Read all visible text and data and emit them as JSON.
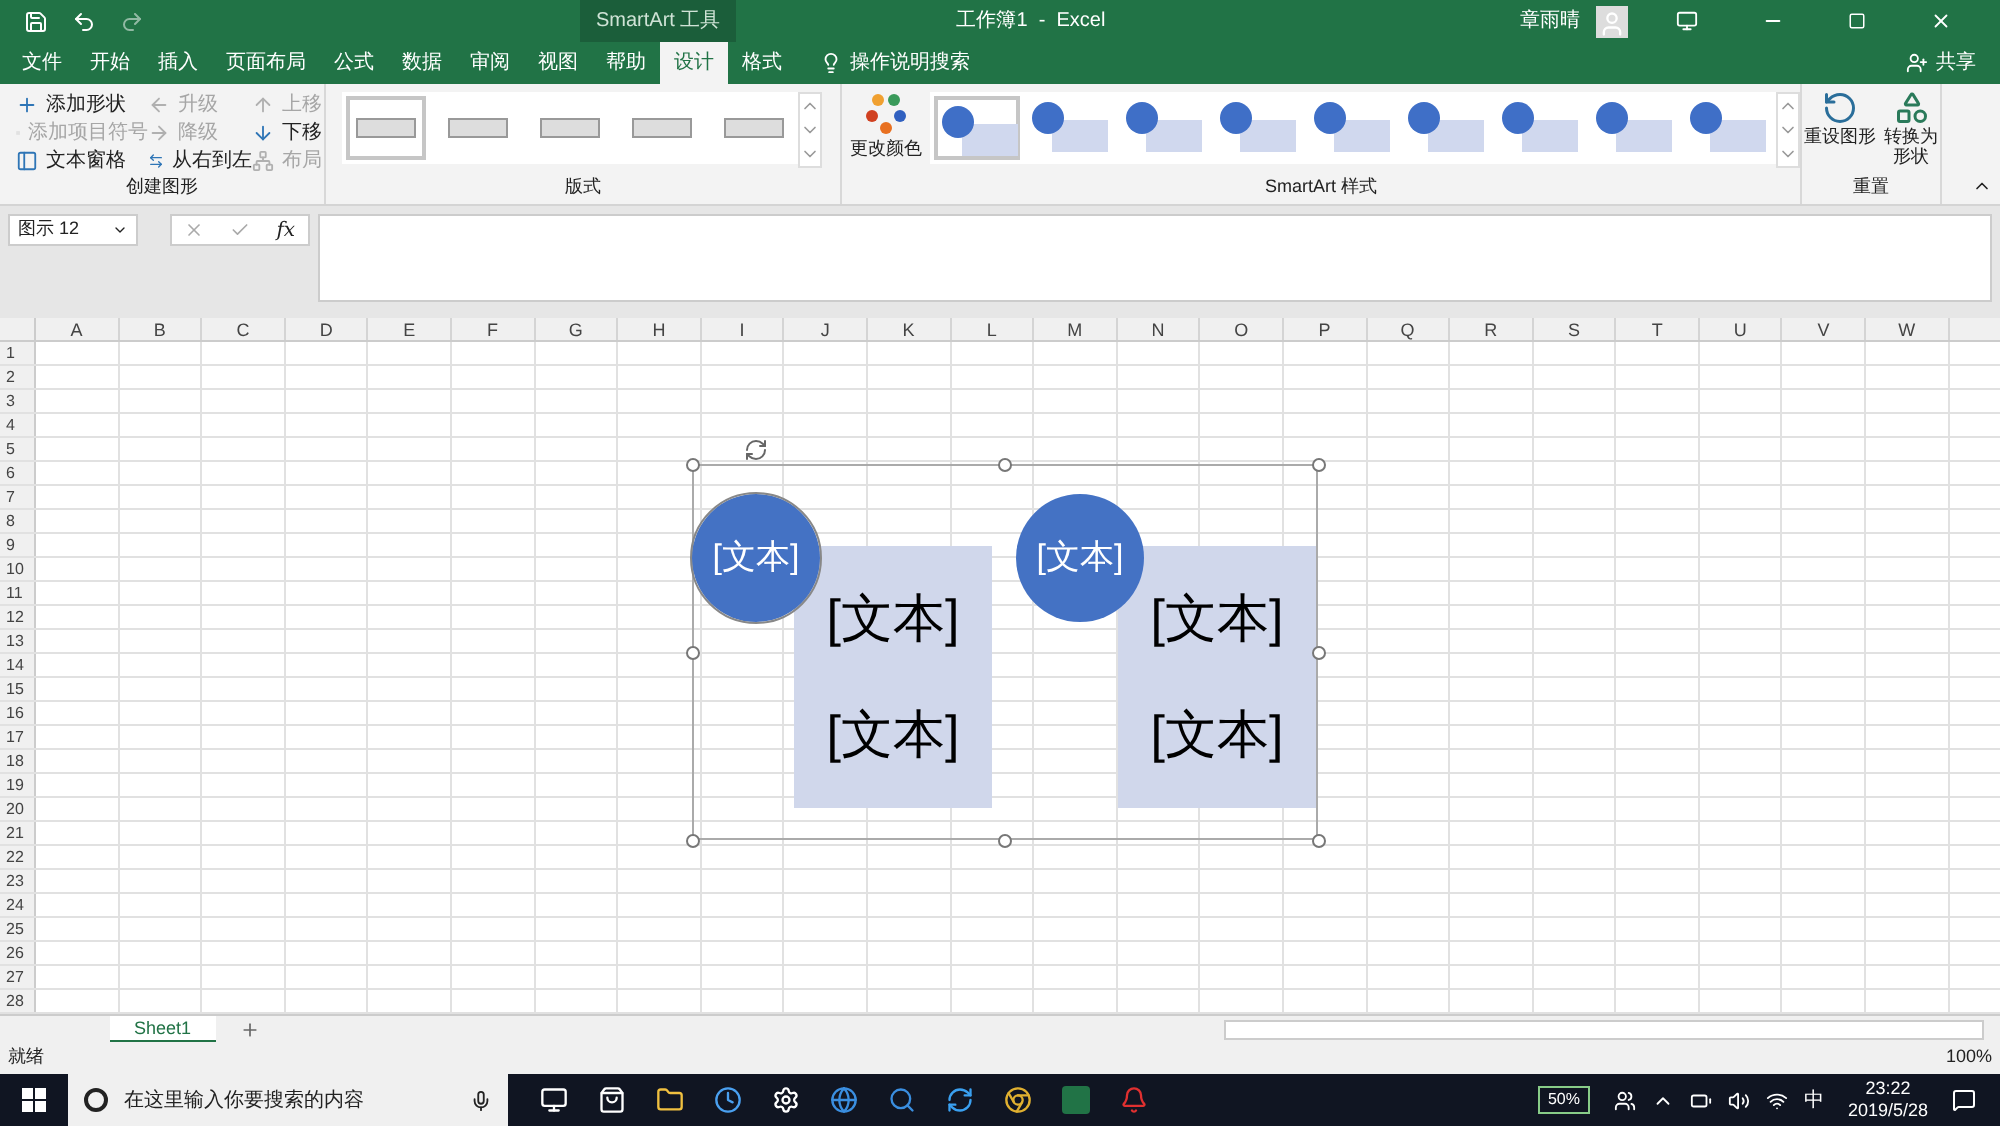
{
  "title_bar": {
    "context_label": "SmartArt 工具",
    "title": "工作簿1  -  Excel",
    "user": "章雨晴"
  },
  "tabs": [
    {
      "label": "文件",
      "selected": false
    },
    {
      "label": "开始",
      "selected": false
    },
    {
      "label": "插入",
      "selected": false
    },
    {
      "label": "页面布局",
      "selected": false
    },
    {
      "label": "公式",
      "selected": false
    },
    {
      "label": "数据",
      "selected": false
    },
    {
      "label": "审阅",
      "selected": false
    },
    {
      "label": "视图",
      "selected": false
    },
    {
      "label": "帮助",
      "selected": false
    },
    {
      "label": "设计",
      "selected": true
    },
    {
      "label": "格式",
      "selected": false
    }
  ],
  "tell_me": "操作说明搜索",
  "share": "共享",
  "create_group": {
    "label": "创建图形",
    "items": [
      {
        "label": "添加形状",
        "disabled": false,
        "kind": "add"
      },
      {
        "label": "升级",
        "disabled": true,
        "kind": "left"
      },
      {
        "label": "上移",
        "disabled": true,
        "kind": "up"
      },
      {
        "label": "添加项目符号",
        "disabled": true,
        "kind": "bullet"
      },
      {
        "label": "降级",
        "disabled": true,
        "kind": "right"
      },
      {
        "label": "下移",
        "disabled": false,
        "kind": "down"
      },
      {
        "label": "文本窗格",
        "disabled": false,
        "kind": "pane"
      },
      {
        "label": "从右到左",
        "disabled": false,
        "kind": "swap"
      },
      {
        "label": "布局",
        "disabled": true,
        "kind": "layout"
      }
    ]
  },
  "layouts_group": {
    "label": "版式"
  },
  "styles_group": {
    "label": "SmartArt 样式",
    "change_color": "更改颜色"
  },
  "reset_group": {
    "label": "重置",
    "buttons": [
      {
        "lines": [
          "重设图形"
        ]
      },
      {
        "lines": [
          "转换为",
          "形状"
        ]
      }
    ]
  },
  "name_box": "图示 12",
  "fx": "fx",
  "columns": [
    "A",
    "B",
    "C",
    "D",
    "E",
    "F",
    "G",
    "H",
    "I",
    "J",
    "K",
    "L",
    "M",
    "N",
    "O",
    "P",
    "Q",
    "R",
    "S",
    "T",
    "U",
    "V",
    "W"
  ],
  "rows": [
    "1",
    "2",
    "3",
    "4",
    "5",
    "6",
    "7",
    "8",
    "9",
    "10",
    "11",
    "12",
    "13",
    "14",
    "15",
    "16",
    "17",
    "18",
    "19",
    "20",
    "21",
    "22",
    "23",
    "24",
    "25",
    "26",
    "27",
    "28"
  ],
  "smartart": [
    {
      "circle": "[文本]",
      "boxes": [
        "[文本]",
        "[文本]"
      ],
      "selected": true
    },
    {
      "circle": "[文本]",
      "boxes": [
        "[文本]",
        "[文本]"
      ],
      "selected": false
    }
  ],
  "sheets": [
    {
      "label": "Sheet1",
      "selected": true
    }
  ],
  "status": "就绪",
  "zoom": "100%",
  "taskbar": {
    "search_placeholder": "在这里输入你要搜索的内容",
    "battery": "50%",
    "ime": "中",
    "time": "23:22",
    "date": "2019/5/28"
  }
}
